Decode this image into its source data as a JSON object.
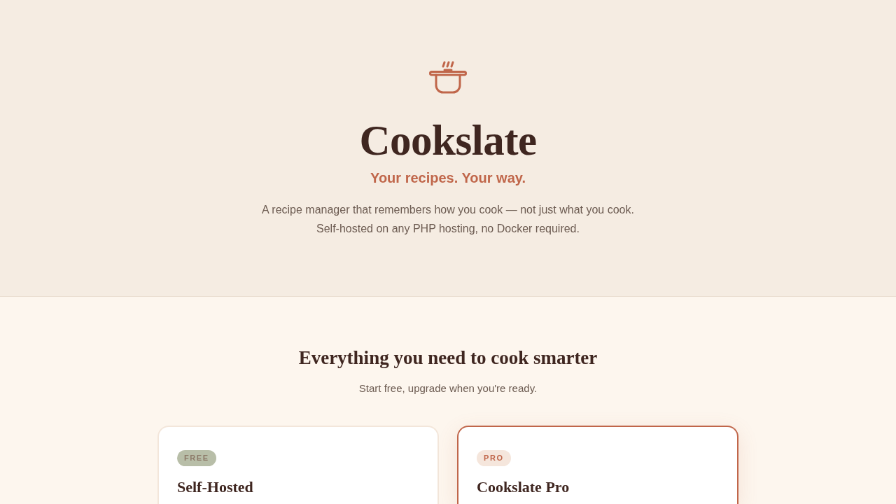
{
  "hero": {
    "title": "Cookslate",
    "tagline": "Your recipes. Your way.",
    "description_lines": [
      "A recipe manager that remembers how you cook — not just what you cook.",
      "Self-hosted on any PHP hosting, no Docker required."
    ]
  },
  "features": {
    "heading": "Everything you need to cook smarter",
    "subheading": "Start free, upgrade when you're ready.",
    "plans": [
      {
        "badge": "FREE",
        "name": "Self-Hosted",
        "featured": false
      },
      {
        "badge": "PRO",
        "name": "Cookslate Pro",
        "featured": true
      }
    ]
  }
}
